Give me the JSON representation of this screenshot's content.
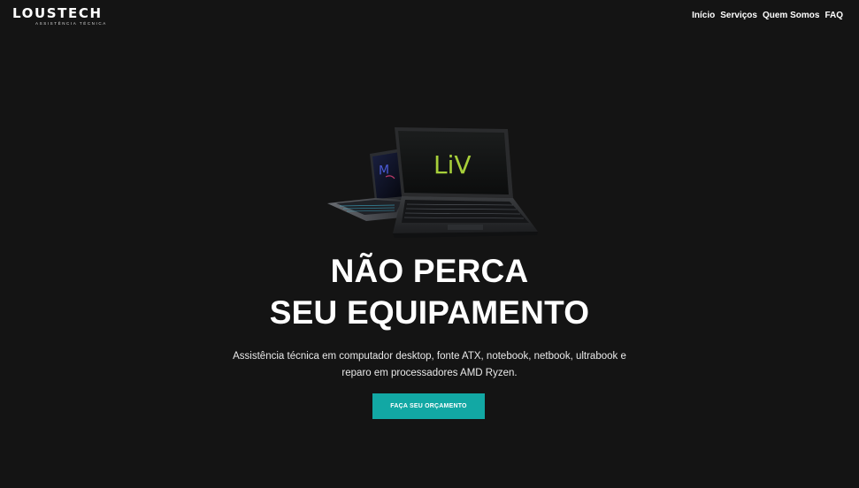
{
  "header": {
    "logo_text": "LOUSTECH",
    "logo_subtitle": "ASSISTÊNCIA TÉCNICA",
    "nav": [
      {
        "label": "Início"
      },
      {
        "label": "Serviços"
      },
      {
        "label": "Quem Somos"
      },
      {
        "label": "FAQ"
      }
    ]
  },
  "hero": {
    "image_icon": "laptops-image",
    "laptop_screen_text": "LiV",
    "headline_line1": "NÃO PERCA",
    "headline_line2": "SEU EQUIPAMENTO",
    "description_line1": "Assistência técnica em computador desktop, fonte ATX, notebook, netbook, ultrabook e",
    "description_line2": "reparo em processadores AMD Ryzen.",
    "cta_label": "FAÇA SEU ORÇAMENTO"
  },
  "colors": {
    "background": "#141414",
    "accent": "#12a8a4",
    "text": "#ffffff"
  }
}
